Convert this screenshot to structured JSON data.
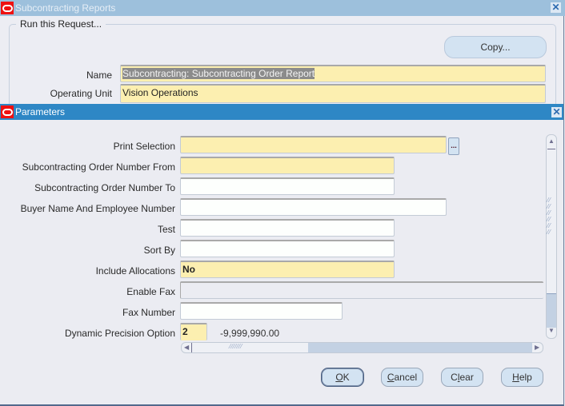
{
  "back_window": {
    "title": "Subcontracting Reports",
    "group_label": "Run this Request...",
    "copy_button": "Copy...",
    "name_label": "Name",
    "name_value": "Subcontracting: Subcontracting Order Report",
    "operating_unit_label": "Operating Unit",
    "operating_unit_value": "Vision Operations"
  },
  "parameters_window": {
    "title": "Parameters",
    "fields": [
      {
        "label": "Print Selection",
        "value": "",
        "required": true
      },
      {
        "label": "Subcontracting Order Number From",
        "value": "",
        "required": true
      },
      {
        "label": "Subcontracting Order Number To",
        "value": ""
      },
      {
        "label": "Buyer Name And Employee Number",
        "value": ""
      },
      {
        "label": "Test",
        "value": ""
      },
      {
        "label": "Sort By",
        "value": ""
      },
      {
        "label": "Include Allocations",
        "value": "No",
        "required": true
      },
      {
        "label": "Enable Fax",
        "value": ""
      },
      {
        "label": "Fax Number",
        "value": ""
      },
      {
        "label": "Dynamic Precision Option",
        "value": "2",
        "required": true
      }
    ],
    "precision_example": "-9,999,990.00",
    "lov_button": "...",
    "buttons": {
      "ok_mnemonic": "O",
      "ok_rest": "K",
      "cancel_mnemonic": "C",
      "cancel_rest": "ancel",
      "clear_pre": "C",
      "clear_mnemonic": "l",
      "clear_rest": "ear",
      "help_mnemonic": "H",
      "help_rest": "elp"
    }
  },
  "icons": {
    "close": "✕",
    "scroll_up": "▲",
    "scroll_down": "▼",
    "scroll_left": "◀",
    "scroll_right": "▶",
    "grip": "⁄⁄⁄⁄⁄⁄⁄"
  },
  "colors": {
    "title_active": "#2e87c5",
    "title_inactive": "#9dc0dc",
    "required_field": "#fcefb0",
    "button": "#d3e3f2"
  }
}
